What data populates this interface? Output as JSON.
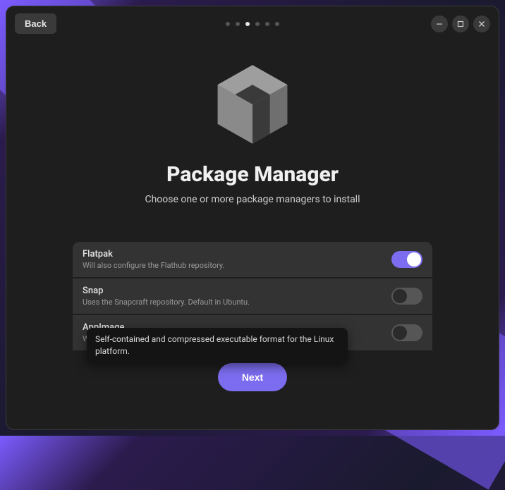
{
  "titlebar": {
    "back_label": "Back"
  },
  "pager": {
    "total": 6,
    "active_index": 2
  },
  "hero": {
    "title": "Package Manager",
    "subtitle": "Choose one or more package managers to install"
  },
  "options": [
    {
      "title": "Flatpak",
      "description": "Will also configure the Flathub repository.",
      "enabled": true
    },
    {
      "title": "Snap",
      "description": "Uses the Snapcraft repository. Default in Ubuntu.",
      "enabled": false
    },
    {
      "title": "AppImage",
      "description": "Will install the necessary dependencies to run AppImages.",
      "enabled": false
    }
  ],
  "tooltip": {
    "text": "Self-contained and compressed executable format for the Linux platform."
  },
  "footer": {
    "next_label": "Next"
  },
  "icons": {
    "minimize": "minimize",
    "maximize": "maximize",
    "close": "close",
    "hero": "package-box"
  },
  "colors": {
    "accent": "#7c6df0",
    "window_bg": "#1e1e1e",
    "row_bg": "#333333"
  }
}
